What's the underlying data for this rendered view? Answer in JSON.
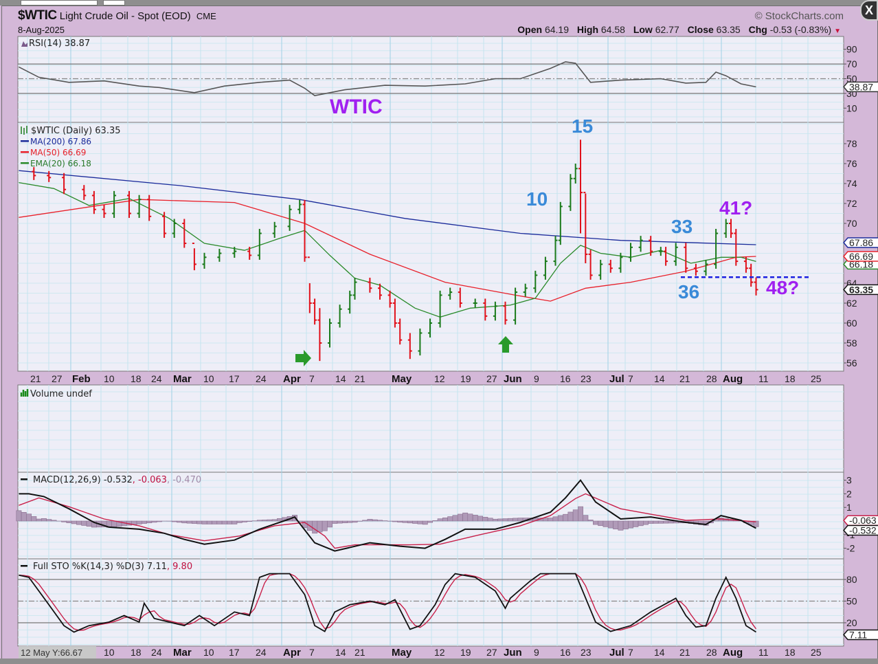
{
  "header": {
    "symbol": "$WTIC",
    "name": "Light Crude Oil - Spot (EOD)",
    "exchange": "CME",
    "date": "8-Aug-2025",
    "brand": "© StockCharts.com",
    "open_label": "Open",
    "open": "64.19",
    "high_label": "High",
    "high": "64.58",
    "low_label": "Low",
    "low": "62.77",
    "close_label": "Close",
    "close": "63.35",
    "chg_label": "Chg",
    "chg": "-0.53 (-0.83%)",
    "close_button": "X"
  },
  "tooltip": "12 May Y:66.67",
  "colors": {
    "up": "#1a7a1a",
    "down": "#e0101a",
    "ma200": "#1a2a9a",
    "ma50": "#e8202a",
    "ema20": "#2a8a2a",
    "annotation_blue": "#3a8ad8",
    "annotation_purple": "#a020f0"
  },
  "chart_data": [
    {
      "panel": "rsi",
      "type": "line",
      "legend": "RSI(14) 38.87",
      "ylim": [
        0,
        100
      ],
      "ticks": [
        "90",
        "70",
        "50",
        "30",
        "10"
      ],
      "tick_values": [
        90,
        70,
        50,
        30,
        10
      ],
      "reference_lines": [
        70,
        50,
        30
      ],
      "last_tag": "38.87",
      "points": [
        [
          -2,
          66
        ],
        [
          2,
          52
        ],
        [
          8,
          45
        ],
        [
          15,
          47
        ],
        [
          22,
          40
        ],
        [
          26,
          38
        ],
        [
          33,
          31
        ],
        [
          39,
          40
        ],
        [
          46,
          45
        ],
        [
          52,
          48
        ],
        [
          55,
          37
        ],
        [
          57,
          27
        ],
        [
          63,
          35
        ],
        [
          71,
          41
        ],
        [
          79,
          40
        ],
        [
          87,
          43
        ],
        [
          93,
          50
        ],
        [
          98,
          50
        ],
        [
          104,
          64
        ],
        [
          107,
          73
        ],
        [
          109,
          71
        ],
        [
          112,
          45
        ],
        [
          118,
          48
        ],
        [
          126,
          50
        ],
        [
          131,
          44
        ],
        [
          135,
          45
        ],
        [
          137,
          59
        ],
        [
          139,
          54
        ],
        [
          142,
          43
        ],
        [
          145,
          38.87
        ]
      ]
    },
    {
      "panel": "price",
      "type": "ohlc",
      "legend": "$WTIC (Daily) 63.35",
      "ylim": [
        55,
        80
      ],
      "ticks": [
        "78",
        "76",
        "74",
        "72",
        "70",
        "64",
        "62",
        "60",
        "58",
        "56"
      ],
      "tick_values": [
        78,
        76,
        74,
        72,
        70,
        64,
        62,
        60,
        58,
        56
      ],
      "x_tick_labels": [
        "21",
        "27",
        "Feb",
        "10",
        "18",
        "24",
        "Mar",
        "10",
        "17",
        "24",
        "Apr",
        "7",
        "14",
        "21",
        "May",
        "12",
        "19",
        "27",
        "Jun",
        "9",
        "16",
        "23",
        "Jul",
        "7",
        "14",
        "21",
        "28",
        "Aug",
        "11",
        "18",
        "25"
      ],
      "closes": [
        [
          1,
          74.8
        ],
        [
          4,
          74.6
        ],
        [
          7,
          73.4
        ],
        [
          11,
          72.8
        ],
        [
          13,
          71.4
        ],
        [
          15,
          71.0
        ],
        [
          17,
          72.8
        ],
        [
          20,
          71.0
        ],
        [
          22,
          72.4
        ],
        [
          24,
          70.7
        ],
        [
          27,
          69.0
        ],
        [
          29,
          70.0
        ],
        [
          31,
          68.0
        ],
        [
          33,
          65.9,
          67.5,
          65.3
        ],
        [
          35,
          66.6
        ],
        [
          38,
          67.0
        ],
        [
          41,
          67.2
        ],
        [
          44,
          66.8
        ],
        [
          46,
          69.0
        ],
        [
          49,
          69.7
        ],
        [
          52,
          71.4
        ],
        [
          54,
          71.9
        ],
        [
          55,
          66.6
        ],
        [
          56,
          62.0,
          64.0,
          61.0
        ],
        [
          57,
          60.3
        ],
        [
          58,
          58.0,
          61.5,
          56.2
        ],
        [
          60,
          60.0
        ],
        [
          62,
          61.4
        ],
        [
          64,
          62.8
        ],
        [
          65,
          64.1
        ],
        [
          68,
          63.5
        ],
        [
          70,
          62.8
        ],
        [
          72,
          62.0
        ],
        [
          73,
          60.0
        ],
        [
          74,
          58.3
        ],
        [
          76,
          57.2,
          59.0,
          56.4
        ],
        [
          78,
          59.0
        ],
        [
          80,
          60.0
        ],
        [
          82,
          62.8
        ],
        [
          84,
          63.1
        ],
        [
          86,
          62.0
        ],
        [
          89,
          62.0
        ],
        [
          91,
          60.7
        ],
        [
          93,
          61.7
        ],
        [
          95,
          60.3
        ],
        [
          97,
          63.1
        ],
        [
          99,
          63.5
        ],
        [
          101,
          64.8
        ],
        [
          103,
          66.2
        ],
        [
          105,
          68.3
        ],
        [
          106,
          71.7
        ],
        [
          108,
          74.5
        ],
        [
          109,
          75.5,
          76.0,
          74.0
        ],
        [
          110,
          73.1,
          78.4,
          69.0
        ],
        [
          111,
          66.9,
          73.0,
          66.0
        ],
        [
          112,
          64.8
        ],
        [
          114,
          65.9
        ],
        [
          116,
          65.5
        ],
        [
          118,
          66.6
        ],
        [
          120,
          67.6
        ],
        [
          122,
          68.3
        ],
        [
          124,
          67.2
        ],
        [
          126,
          67.2
        ],
        [
          127,
          66.2
        ],
        [
          129,
          67.6
        ],
        [
          131,
          65.5
        ],
        [
          133,
          65.2
        ],
        [
          135,
          65.9
        ],
        [
          137,
          69.0
        ],
        [
          139,
          70.0
        ],
        [
          140,
          69.0
        ],
        [
          141,
          66.2
        ],
        [
          143,
          65.5
        ],
        [
          144,
          64.1
        ],
        [
          145,
          63.35,
          64.58,
          62.77
        ]
      ],
      "series": [
        {
          "name": "MA(200) 67.86",
          "tag": "67.86",
          "points": [
            [
              -2,
              75.3
            ],
            [
              30,
              73.8
            ],
            [
              54,
              72.4
            ],
            [
              75,
              70.5
            ],
            [
              98,
              69.0
            ],
            [
              118,
              68.3
            ],
            [
              145,
              67.86
            ]
          ]
        },
        {
          "name": "MA(50) 66.69",
          "tag": "66.69",
          "points": [
            [
              -2,
              70.6
            ],
            [
              22,
              72.4
            ],
            [
              41,
              72.1
            ],
            [
              55,
              70.0
            ],
            [
              68,
              66.9
            ],
            [
              83,
              64.1
            ],
            [
              97,
              62.8
            ],
            [
              104,
              62.2
            ],
            [
              111,
              63.5
            ],
            [
              120,
              64.1
            ],
            [
              131,
              65.2
            ],
            [
              141,
              66.6
            ],
            [
              145,
              66.69
            ]
          ]
        },
        {
          "name": "EMA(20) 66.18",
          "tag": "66.18",
          "points": [
            [
              -2,
              74.1
            ],
            [
              5,
              73.5
            ],
            [
              12,
              71.8
            ],
            [
              20,
              72.5
            ],
            [
              28,
              70.5
            ],
            [
              35,
              68.0
            ],
            [
              43,
              67.3
            ],
            [
              50,
              68.5
            ],
            [
              55,
              69.3
            ],
            [
              60,
              66.8
            ],
            [
              65,
              64.5
            ],
            [
              70,
              63.8
            ],
            [
              77,
              61.5
            ],
            [
              82,
              60.6
            ],
            [
              88,
              61.5
            ],
            [
              96,
              61.8
            ],
            [
              101,
              62.5
            ],
            [
              106,
              66.0
            ],
            [
              110,
              67.8
            ],
            [
              114,
              67.0
            ],
            [
              120,
              66.6
            ],
            [
              126,
              67.3
            ],
            [
              132,
              66.0
            ],
            [
              138,
              66.6
            ],
            [
              142,
              66.6
            ],
            [
              145,
              66.18
            ]
          ]
        }
      ],
      "last_tag": "63.35",
      "support_line": {
        "value": 64.6,
        "from": 130,
        "to": 156
      },
      "annotations": [
        {
          "text": "WTIC",
          "color": "purple",
          "panel": "rsi"
        },
        {
          "text": "15",
          "color": "blue"
        },
        {
          "text": "10",
          "color": "blue"
        },
        {
          "text": "33",
          "color": "blue"
        },
        {
          "text": "41?",
          "color": "purple"
        },
        {
          "text": "36",
          "color": "blue"
        },
        {
          "text": "48?",
          "color": "purple"
        }
      ],
      "arrows": [
        {
          "direction": "right",
          "day": 55
        },
        {
          "direction": "up",
          "day": 95
        }
      ]
    },
    {
      "panel": "volume",
      "type": "bar",
      "legend": "Volume undef"
    },
    {
      "panel": "macd",
      "type": "line",
      "legend_main": "MACD(12,26,9) -0.532",
      "legend_signal": ", -0.063",
      "legend_hist": ", -0.470",
      "ylim": [
        -3,
        3.5
      ],
      "ticks": [
        "3",
        "2",
        "1",
        "-1",
        "-2"
      ],
      "tick_values": [
        3,
        2,
        1,
        -1,
        -2
      ],
      "tag_macd": "-0.532",
      "tag_signal": "-0.063",
      "macd": [
        [
          -2,
          2.0
        ],
        [
          0,
          2.0
        ],
        [
          3,
          1.8
        ],
        [
          8,
          0.9
        ],
        [
          13,
          -0.1
        ],
        [
          16,
          -0.45
        ],
        [
          22,
          -0.6
        ],
        [
          27,
          -0.9
        ],
        [
          31,
          -1.35
        ],
        [
          35,
          -1.7
        ],
        [
          41,
          -1.4
        ],
        [
          46,
          -0.6
        ],
        [
          52,
          0.15
        ],
        [
          53,
          0.3
        ],
        [
          57,
          -1.6
        ],
        [
          61,
          -2.2
        ],
        [
          68,
          -1.6
        ],
        [
          74,
          -1.85
        ],
        [
          79,
          -2.0
        ],
        [
          83,
          -1.35
        ],
        [
          87,
          -0.6
        ],
        [
          93,
          -0.6
        ],
        [
          98,
          -0.1
        ],
        [
          104,
          0.65
        ],
        [
          107,
          1.7
        ],
        [
          110,
          3.0
        ],
        [
          113,
          1.4
        ],
        [
          118,
          0.15
        ],
        [
          124,
          0.3
        ],
        [
          131,
          -0.1
        ],
        [
          135,
          -0.25
        ],
        [
          138,
          0.4
        ],
        [
          142,
          0.05
        ],
        [
          145,
          -0.532
        ]
      ],
      "signal": [
        [
          -2,
          1.15
        ],
        [
          2,
          1.7
        ],
        [
          8,
          1.05
        ],
        [
          15,
          0.15
        ],
        [
          22,
          -0.35
        ],
        [
          28,
          -1.0
        ],
        [
          35,
          -1.45
        ],
        [
          42,
          -1.1
        ],
        [
          49,
          -0.35
        ],
        [
          55,
          -0.1
        ],
        [
          59,
          -1.1
        ],
        [
          61,
          -2.0
        ],
        [
          65,
          -1.75
        ],
        [
          76,
          -1.75
        ],
        [
          82,
          -1.7
        ],
        [
          90,
          -1.0
        ],
        [
          98,
          -0.35
        ],
        [
          104,
          0.4
        ],
        [
          109,
          1.65
        ],
        [
          111,
          2.0
        ],
        [
          118,
          0.9
        ],
        [
          124,
          0.5
        ],
        [
          131,
          0.05
        ],
        [
          138,
          0.15
        ],
        [
          145,
          -0.063
        ]
      ]
    },
    {
      "panel": "stochastic",
      "type": "line",
      "legend_main": "Full STO %K(14,3) %D(3) 7.11",
      "legend_d": ", 9.80",
      "ylim": [
        0,
        100
      ],
      "ticks": [
        "80",
        "50",
        "20"
      ],
      "tick_values": [
        80,
        50,
        20
      ],
      "reference_lines": [
        80,
        50,
        20
      ],
      "last_tag": "7.11",
      "k": [
        [
          -2,
          86
        ],
        [
          0,
          83
        ],
        [
          4,
          45
        ],
        [
          7,
          16
        ],
        [
          9,
          7
        ],
        [
          12,
          16
        ],
        [
          16,
          21
        ],
        [
          19,
          30
        ],
        [
          22,
          21
        ],
        [
          23,
          47
        ],
        [
          25,
          26
        ],
        [
          28,
          21
        ],
        [
          31,
          16
        ],
        [
          34,
          30
        ],
        [
          37,
          16
        ],
        [
          41,
          35
        ],
        [
          44,
          30
        ],
        [
          46,
          83
        ],
        [
          48,
          88
        ],
        [
          52,
          88
        ],
        [
          55,
          59
        ],
        [
          57,
          16
        ],
        [
          59,
          8
        ],
        [
          61,
          35
        ],
        [
          64,
          45
        ],
        [
          68,
          50
        ],
        [
          71,
          45
        ],
        [
          73,
          52
        ],
        [
          76,
          11
        ],
        [
          78,
          16
        ],
        [
          81,
          45
        ],
        [
          83,
          73
        ],
        [
          85,
          88
        ],
        [
          89,
          83
        ],
        [
          93,
          64
        ],
        [
          95,
          40
        ],
        [
          96,
          54
        ],
        [
          100,
          78
        ],
        [
          102,
          88
        ],
        [
          109,
          88
        ],
        [
          113,
          21
        ],
        [
          116,
          8
        ],
        [
          120,
          16
        ],
        [
          124,
          35
        ],
        [
          129,
          54
        ],
        [
          131,
          30
        ],
        [
          133,
          14
        ],
        [
          135,
          16
        ],
        [
          137,
          54
        ],
        [
          139,
          83
        ],
        [
          141,
          54
        ],
        [
          143,
          16
        ],
        [
          145,
          7.11
        ]
      ]
    }
  ]
}
